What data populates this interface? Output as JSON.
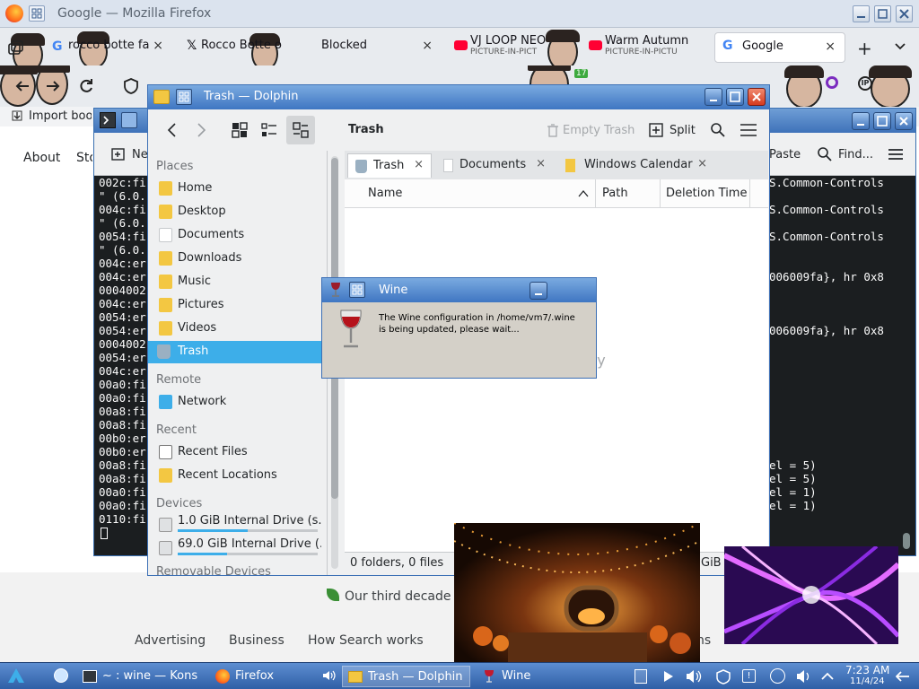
{
  "firefox": {
    "title": "Google — Mozilla Firefox",
    "tabs": [
      {
        "label": "rocco botte fa",
        "icon": "google-icon"
      },
      {
        "label": "Rocco Botte o",
        "icon": "x-logo-icon"
      },
      {
        "label": "Blocked",
        "icon": "none"
      },
      {
        "label": "VJ LOOP NEO",
        "sub": "PICTURE-IN-PICT",
        "icon": "youtube-icon"
      },
      {
        "label": "Warm Autumn",
        "sub": "PICTURE-IN-PICTU",
        "icon": "youtube-icon"
      },
      {
        "label": "Google",
        "icon": "google-icon"
      }
    ],
    "bookmark": "Import boo",
    "nav_badge": "17",
    "page_links": {
      "about": "About",
      "store": "Sto",
      "advertising": "Advertising",
      "business": "Business",
      "how": "How Search works",
      "privacy_partial": "ns",
      "tagline": "Our third decade o"
    }
  },
  "konsole": {
    "toolbar": {
      "new": "Ne",
      "paste": "Paste",
      "find": "Find..."
    },
    "left_lines": [
      "002c:fi",
      "\" (6.0.",
      "004c:fi",
      "\" (6.0.",
      "0054:fi",
      "\" (6.0.",
      "004c:er",
      "004c:er",
      "0004002",
      "004c:er",
      "0054:er",
      "0054:er",
      "0004002",
      "0054:er",
      "004c:er",
      "00a0:fi",
      "00a0:fi",
      "00a8:fi",
      "00a8:fi",
      "00b0:er",
      "00b0:er",
      "00a8:fi",
      "00a8:fi",
      "00a0:fi",
      "00a0:fi",
      "0110:fi"
    ],
    "right_lines": [
      {
        "row": 0,
        "text": "S.Common-Controls"
      },
      {
        "row": 2,
        "text": "S.Common-Controls"
      },
      {
        "row": 4,
        "text": "S.Common-Controls"
      },
      {
        "row": 7,
        "text": "006009fa}, hr 0x8"
      },
      {
        "row": 11,
        "text": "006009fa}, hr 0x8"
      },
      {
        "row": 21,
        "text": "el = 5)"
      },
      {
        "row": 22,
        "text": "el = 5)"
      },
      {
        "row": 23,
        "text": "el = 1)"
      },
      {
        "row": 24,
        "text": "el = 1)"
      }
    ]
  },
  "dolphin": {
    "title": "Trash — Dolphin",
    "location": "Trash",
    "empty_trash": "Empty Trash",
    "split": "Split",
    "sections": {
      "places": "Places",
      "remote": "Remote",
      "recent": "Recent",
      "devices": "Devices",
      "removable": "Removable Devices"
    },
    "places": [
      "Home",
      "Desktop",
      "Documents",
      "Downloads",
      "Music",
      "Pictures",
      "Videos",
      "Trash"
    ],
    "remote": [
      "Network"
    ],
    "recent": [
      "Recent Files",
      "Recent Locations"
    ],
    "devices": [
      {
        "label": "1.0 GiB Internal Drive (s...",
        "used": 0.5
      },
      {
        "label": "69.0 GiB Internal Drive (...",
        "used": 0.35
      }
    ],
    "tabs": [
      "Trash",
      "Documents",
      "Windows Calendar"
    ],
    "columns": [
      "Name",
      "Path",
      "Deletion Time"
    ],
    "empty_hint": "ty",
    "status": "0 folders, 0 files",
    "status_right": "GiB fr"
  },
  "wine": {
    "title": "Wine",
    "message": "The Wine configuration in /home/vm7/.wine is being updated, please wait..."
  },
  "taskbar": {
    "tasks": [
      {
        "label": "~ : wine — Kons"
      },
      {
        "label": "Firefox"
      },
      {
        "label": "Trash — Dolphin"
      },
      {
        "label": "Wine"
      }
    ],
    "time": "7:23 AM",
    "date": "11/4/24"
  }
}
